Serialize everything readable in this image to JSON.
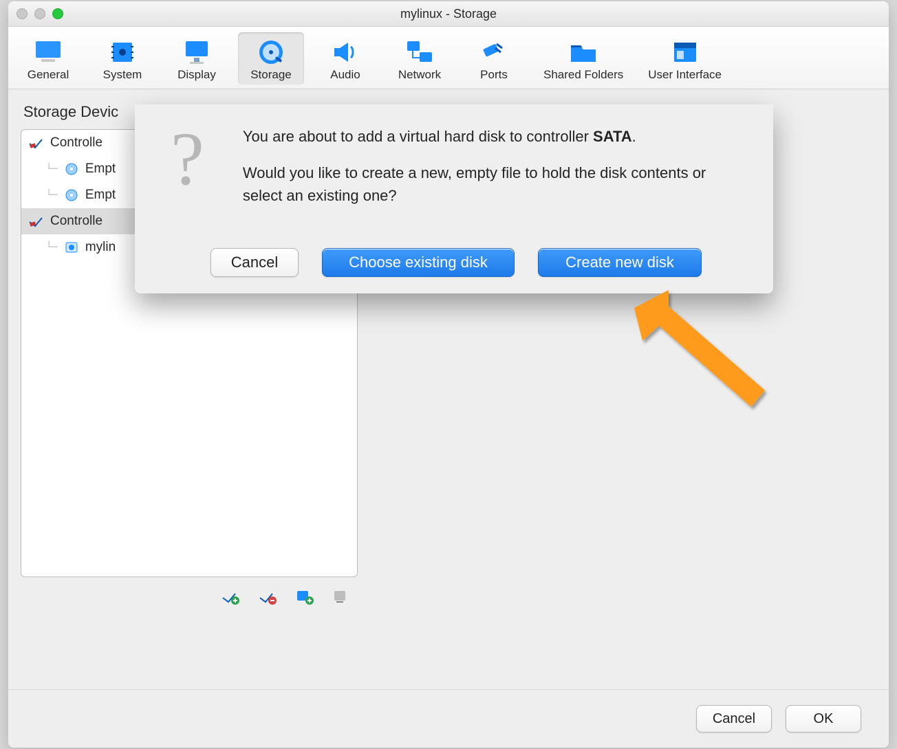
{
  "window": {
    "title": "mylinux - Storage"
  },
  "toolbar": {
    "items": [
      {
        "key": "general",
        "label": "General"
      },
      {
        "key": "system",
        "label": "System"
      },
      {
        "key": "display",
        "label": "Display"
      },
      {
        "key": "storage",
        "label": "Storage",
        "selected": true
      },
      {
        "key": "audio",
        "label": "Audio"
      },
      {
        "key": "network",
        "label": "Network"
      },
      {
        "key": "ports",
        "label": "Ports"
      },
      {
        "key": "shared",
        "label": "Shared Folders"
      },
      {
        "key": "ui",
        "label": "User Interface"
      }
    ]
  },
  "panel": {
    "heading": "Storage Devic",
    "tree": [
      {
        "label": "Controlle",
        "level": 0,
        "kind": "controller",
        "selected": false
      },
      {
        "label": "Empt",
        "level": 1,
        "kind": "disc",
        "selected": false
      },
      {
        "label": "Empt",
        "level": 1,
        "kind": "disc",
        "selected": false
      },
      {
        "label": "Controlle",
        "level": 0,
        "kind": "controller",
        "selected": true
      },
      {
        "label": "mylin",
        "level": 1,
        "kind": "hdd",
        "selected": false
      }
    ]
  },
  "dialog": {
    "line1_pre": "You are about to add a virtual hard disk to controller ",
    "line1_bold": "SATA",
    "line1_post": ".",
    "line2": "Would you like to create a new, empty file to hold the disk contents or select an existing one?",
    "cancel": "Cancel",
    "choose": "Choose existing disk",
    "create": "Create new disk"
  },
  "footer": {
    "cancel": "Cancel",
    "ok": "OK"
  }
}
